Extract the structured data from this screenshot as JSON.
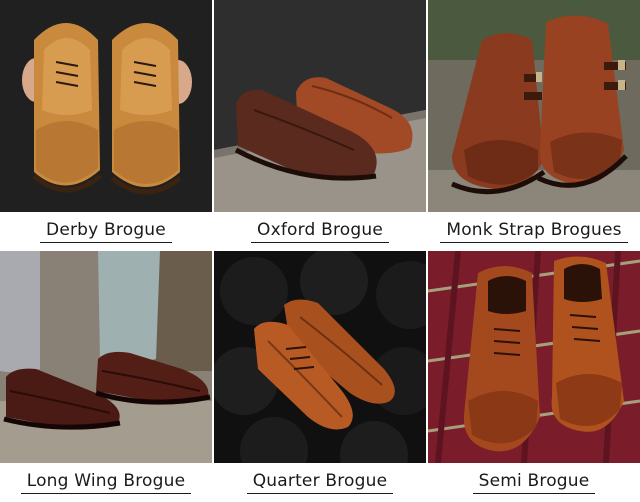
{
  "tiles": [
    {
      "label": "Derby Brogue"
    },
    {
      "label": "Oxford Brogue"
    },
    {
      "label": "Monk Strap Brogues"
    },
    {
      "label": "Long Wing Brogue"
    },
    {
      "label": "Quarter Brogue"
    },
    {
      "label": "Semi Brogue"
    }
  ],
  "colors": {
    "tan_leather": "#c98a3e",
    "dark_brown": "#5a2a1e",
    "chestnut": "#9a4a22",
    "caption_text": "#1a1a1a"
  }
}
